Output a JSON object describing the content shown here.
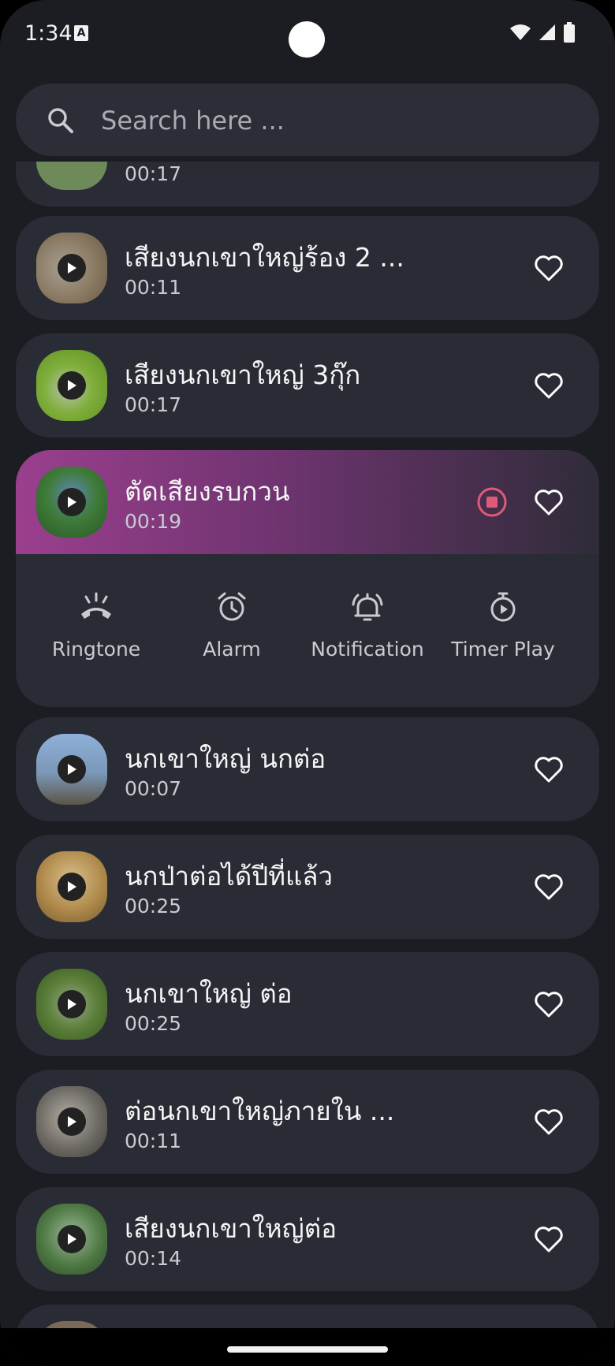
{
  "status": {
    "time": "1:34",
    "notif_glyph": "A"
  },
  "search": {
    "placeholder": "Search here ..."
  },
  "items": [
    {
      "title": "",
      "duration": "00:17",
      "thumb_color": "#6e8a5a"
    },
    {
      "title": "เสียงนกเขาใหญ่ร้อง 2 ...",
      "duration": "00:11",
      "thumb_color": "#8b7a63"
    },
    {
      "title": "เสียงนกเขาใหญ่ 3กุ๊ก",
      "duration": "00:17",
      "thumb_color": "#7fae3a"
    },
    {
      "title": "ตัดเสียงรบกวน",
      "duration": "00:19",
      "thumb_color": "#3f7c3a"
    },
    {
      "title": "นกเขาใหญ่ นกต่อ",
      "duration": "00:07",
      "thumb_color": "#7a98b8"
    },
    {
      "title": "นกป่าต่อได้ปีที่แล้ว",
      "duration": "00:25",
      "thumb_color": "#b08a4c"
    },
    {
      "title": "นกเขาใหญ่ ต่อ",
      "duration": "00:25",
      "thumb_color": "#5c7f3a"
    },
    {
      "title": "ต่อนกเขาใหญ่ภายใน ...",
      "duration": "00:11",
      "thumb_color": "#6d6a64"
    },
    {
      "title": "เสียงนกเขาใหญ่ต่อ",
      "duration": "00:14",
      "thumb_color": "#4f7a45"
    }
  ],
  "actions": {
    "ringtone": "Ringtone",
    "alarm": "Alarm",
    "notification": "Notification",
    "timer": "Timer Play"
  },
  "colors": {
    "accent": "#9b3f8e",
    "stop": "#e05a78",
    "card": "#292c35",
    "bg": "#1b1d22"
  }
}
